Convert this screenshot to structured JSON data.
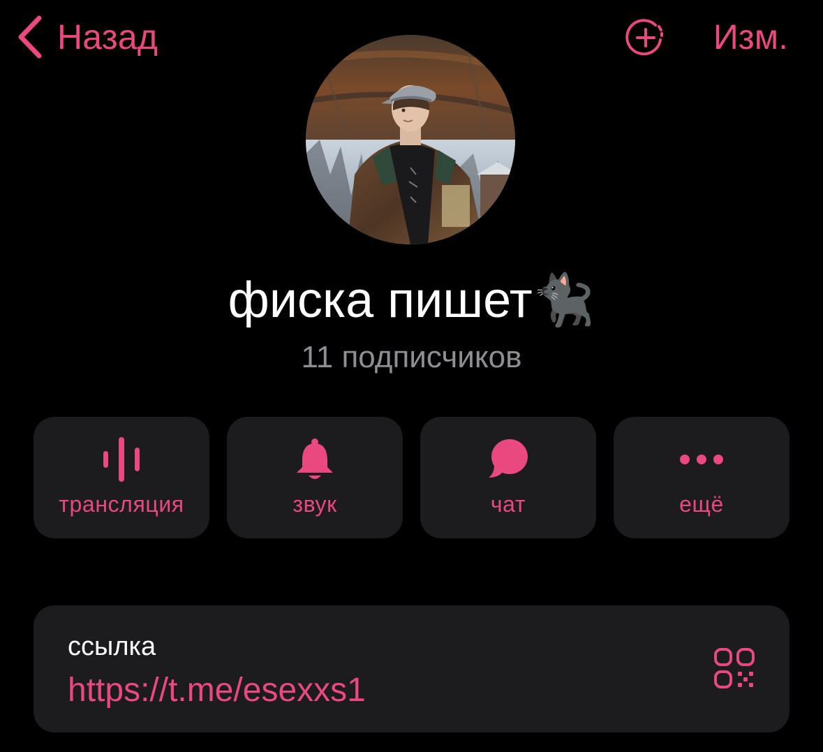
{
  "colors": {
    "accent": "#e9497f",
    "background": "#000000",
    "card": "#1c1c1e",
    "secondary_text": "#8e8e93"
  },
  "nav": {
    "back_label": "Назад",
    "back_icon": "chevron-left-icon",
    "story_icon": "add-story-icon",
    "edit_label": "Изм."
  },
  "channel": {
    "title": "фиска пишет🐈‍⬛",
    "subscribers": "11 подписчиков"
  },
  "actions": [
    {
      "label": "трансляция",
      "icon": "waveform-icon"
    },
    {
      "label": "звук",
      "icon": "bell-icon"
    },
    {
      "label": "чат",
      "icon": "chat-bubble-icon"
    },
    {
      "label": "ещё",
      "icon": "ellipsis-icon"
    }
  ],
  "link": {
    "caption": "ссылка",
    "url": "https://t.me/esexxs1",
    "qr_icon": "qr-code-icon"
  }
}
